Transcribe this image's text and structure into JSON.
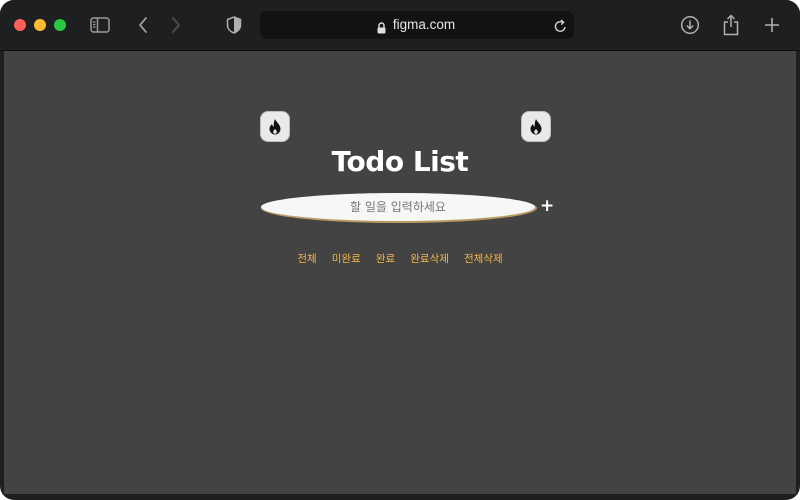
{
  "browser": {
    "url": "figma.com",
    "icons": {
      "sidebar": "sidebar-icon",
      "back": "chevron-left-icon",
      "forward": "chevron-right-icon",
      "shield": "shield-icon",
      "lock": "lock-icon",
      "reload": "reload-icon",
      "download": "download-icon",
      "share": "share-icon",
      "new_tab": "plus-icon"
    }
  },
  "app": {
    "title": "Todo List",
    "input_placeholder": "할 일을 입력하세요",
    "add_label": "+",
    "filters": [
      "전체",
      "미완료",
      "완료",
      "완료삭제",
      "전체삭제"
    ],
    "icons": [
      "fire-icon",
      "fire-icon"
    ]
  },
  "colors": {
    "background": "#434343",
    "title": "#ffffff",
    "filter_text": "#f2b64a",
    "input_shadow": "#b89b63"
  }
}
